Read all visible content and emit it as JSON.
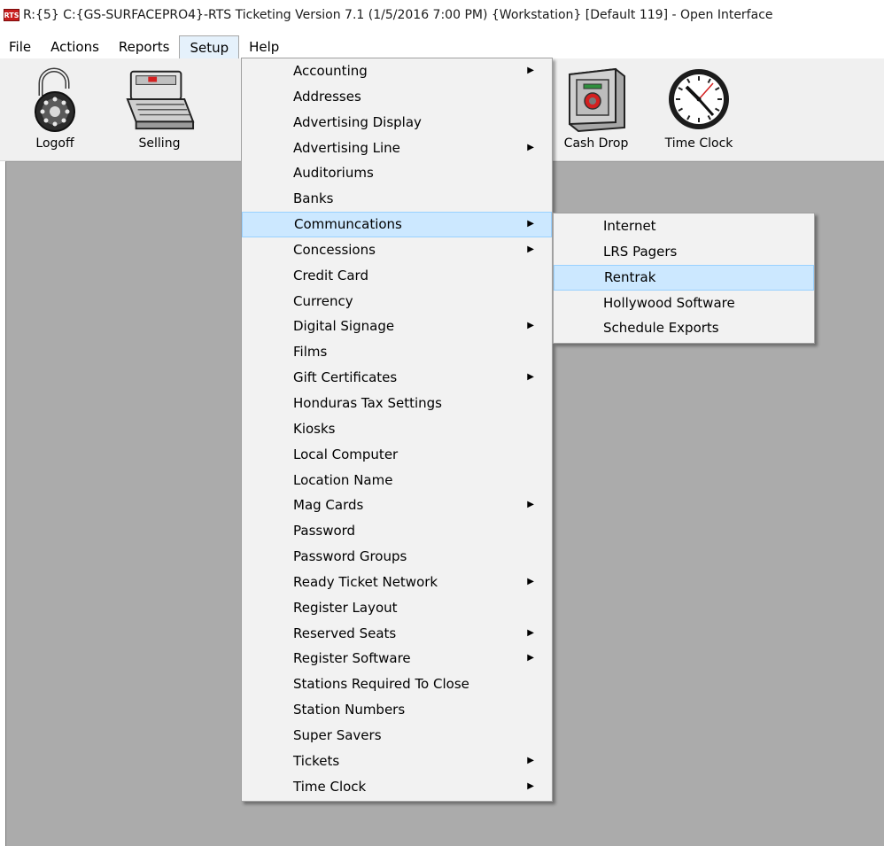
{
  "window": {
    "icon_text": "RTS",
    "title": "R:{5} C:{GS-SURFACEPRO4}-RTS Ticketing Version 7.1 (1/5/2016 7:00 PM) {Workstation} [Default 119] - Open Interface"
  },
  "menubar": {
    "items": [
      {
        "label": "File"
      },
      {
        "label": "Actions"
      },
      {
        "label": "Reports"
      },
      {
        "label": "Setup"
      },
      {
        "label": "Help"
      }
    ]
  },
  "toolbar": {
    "items": [
      {
        "label": "Logoff",
        "icon": "padlock-icon"
      },
      {
        "label": "Selling",
        "icon": "cash-register-icon"
      },
      {
        "label": "Cash Drop",
        "icon": "safe-icon"
      },
      {
        "label": "Time Clock",
        "icon": "clock-icon"
      }
    ]
  },
  "setup_menu": {
    "items": [
      {
        "label": "Accounting",
        "submenu": true
      },
      {
        "label": "Addresses",
        "submenu": false
      },
      {
        "label": "Advertising Display",
        "submenu": false
      },
      {
        "label": "Advertising Line",
        "submenu": true
      },
      {
        "label": "Auditoriums",
        "submenu": false
      },
      {
        "label": "Banks",
        "submenu": false
      },
      {
        "label": "Communcations",
        "submenu": true,
        "highlighted": true
      },
      {
        "label": "Concessions",
        "submenu": true
      },
      {
        "label": "Credit Card",
        "submenu": false
      },
      {
        "label": "Currency",
        "submenu": false
      },
      {
        "label": "Digital Signage",
        "submenu": true
      },
      {
        "label": "Films",
        "submenu": false
      },
      {
        "label": "Gift Certificates",
        "submenu": true
      },
      {
        "label": "Honduras Tax Settings",
        "submenu": false
      },
      {
        "label": "Kiosks",
        "submenu": false
      },
      {
        "label": "Local Computer",
        "submenu": false
      },
      {
        "label": "Location Name",
        "submenu": false
      },
      {
        "label": "Mag Cards",
        "submenu": true
      },
      {
        "label": "Password",
        "submenu": false
      },
      {
        "label": "Password Groups",
        "submenu": false
      },
      {
        "label": "Ready Ticket Network",
        "submenu": true
      },
      {
        "label": "Register Layout",
        "submenu": false
      },
      {
        "label": "Reserved Seats",
        "submenu": true
      },
      {
        "label": "Register Software",
        "submenu": true
      },
      {
        "label": "Stations Required To Close",
        "submenu": false
      },
      {
        "label": "Station Numbers",
        "submenu": false
      },
      {
        "label": "Super Savers",
        "submenu": false
      },
      {
        "label": "Tickets",
        "submenu": true
      },
      {
        "label": "Time Clock",
        "submenu": true
      }
    ]
  },
  "communications_menu": {
    "items": [
      {
        "label": "Internet"
      },
      {
        "label": "LRS Pagers"
      },
      {
        "label": "Rentrak",
        "highlighted": true
      },
      {
        "label": "Hollywood Software"
      },
      {
        "label": "Schedule Exports"
      }
    ]
  },
  "submenu_arrow": "▶"
}
